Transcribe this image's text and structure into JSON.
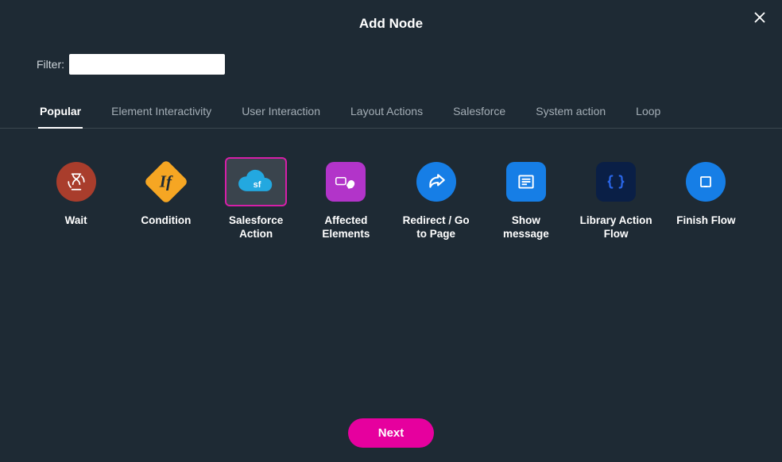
{
  "modal": {
    "title": "Add Node",
    "close_tooltip": "Close"
  },
  "filter": {
    "label": "Filter:",
    "value": "",
    "placeholder": ""
  },
  "tabs": [
    {
      "label": "Popular",
      "active": true
    },
    {
      "label": "Element Interactivity",
      "active": false
    },
    {
      "label": "User Interaction",
      "active": false
    },
    {
      "label": "Layout Actions",
      "active": false
    },
    {
      "label": "Salesforce",
      "active": false
    },
    {
      "label": "System action",
      "active": false
    },
    {
      "label": "Loop",
      "active": false
    }
  ],
  "nodes": [
    {
      "id": "wait",
      "label": "Wait",
      "icon": "hourglass-icon",
      "bg": "#a93d2c",
      "selected": false
    },
    {
      "id": "condition",
      "label": "Condition",
      "icon": "diamond-if-icon",
      "bg": "#f6a623",
      "selected": false
    },
    {
      "id": "salesforce-action",
      "label": "Salesforce Action",
      "icon": "cloud-sf-icon",
      "bg": "#1a9adf",
      "selected": true
    },
    {
      "id": "affected-elements",
      "label": "Affected Elements",
      "icon": "hand-tap-icon",
      "bg": "#b234c9",
      "selected": false
    },
    {
      "id": "redirect",
      "label": "Redirect / Go to Page",
      "icon": "share-arrow-icon",
      "bg": "#167ee6",
      "selected": false
    },
    {
      "id": "show-message",
      "label": "Show message",
      "icon": "message-lines-icon",
      "bg": "#167ee6",
      "selected": false
    },
    {
      "id": "library-action-flow",
      "label": "Library Action Flow",
      "icon": "code-braces-icon",
      "bg": "#0a1f46",
      "selected": false
    },
    {
      "id": "finish-flow",
      "label": "Finish Flow",
      "icon": "stop-square-icon",
      "bg": "#167ee6",
      "selected": false
    }
  ],
  "footer": {
    "next_label": "Next"
  },
  "colors": {
    "accent": "#e6009e",
    "panel": "#1e2a34"
  }
}
